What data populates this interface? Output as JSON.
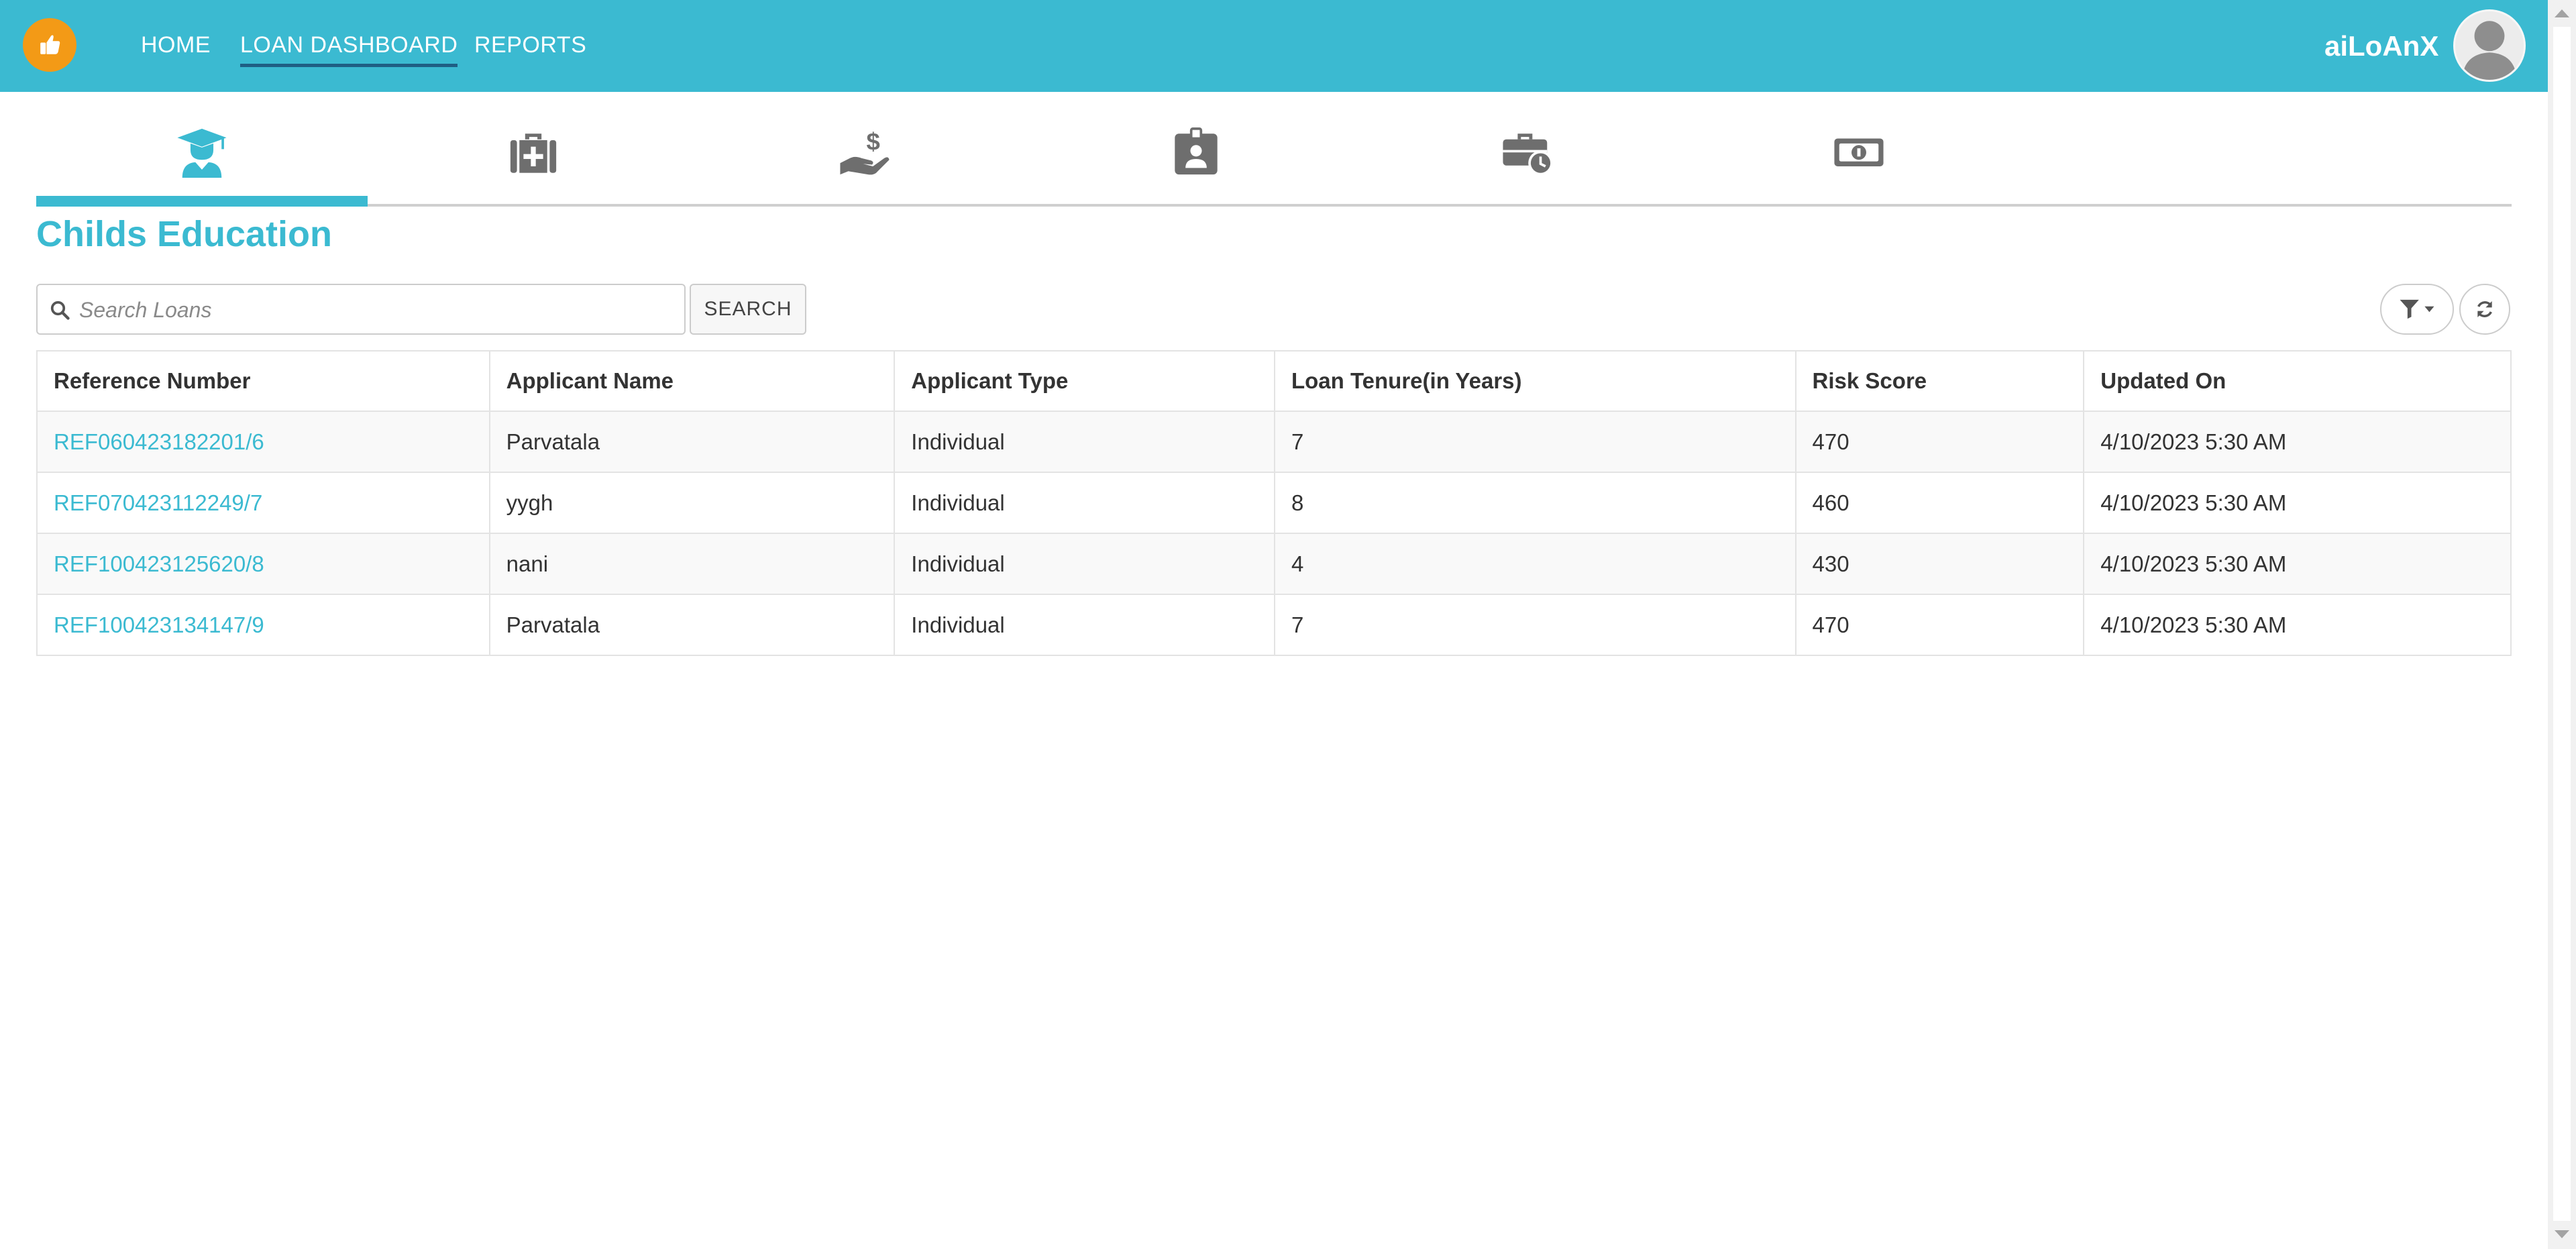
{
  "header": {
    "nav": [
      {
        "label": "HOME"
      },
      {
        "label": "LOAN DASHBOARD"
      },
      {
        "label": "REPORTS"
      }
    ],
    "brand": "aiLoAnX"
  },
  "tabs": [
    {
      "icon": "graduate-icon",
      "active": true
    },
    {
      "icon": "medical-kit-icon",
      "active": false
    },
    {
      "icon": "hand-dollar-icon",
      "active": false
    },
    {
      "icon": "id-badge-icon",
      "active": false
    },
    {
      "icon": "briefcase-clock-icon",
      "active": false
    },
    {
      "icon": "money-bill-icon",
      "active": false
    }
  ],
  "page": {
    "title": "Childs Education"
  },
  "search": {
    "placeholder": "Search Loans",
    "value": "",
    "button_label": "SEARCH"
  },
  "table": {
    "columns": [
      "Reference Number",
      "Applicant Name",
      "Applicant Type",
      "Loan Tenure(in Years)",
      "Risk Score",
      "Updated On"
    ],
    "rows": [
      [
        "REF060423182201/6",
        "Parvatala",
        "Individual",
        "7",
        "470",
        "4/10/2023 5:30 AM"
      ],
      [
        "REF070423112249/7",
        "yygh",
        "Individual",
        "8",
        "460",
        "4/10/2023 5:30 AM"
      ],
      [
        "REF100423125620/8",
        "nani",
        "Individual",
        "4",
        "430",
        "4/10/2023 5:30 AM"
      ],
      [
        "REF100423134147/9",
        "Parvatala",
        "Individual",
        "7",
        "470",
        "4/10/2023 5:30 AM"
      ]
    ]
  },
  "colors": {
    "accent": "#3bbad1",
    "logo": "#f39a16",
    "nav_underline": "#1f5f84",
    "icon_inactive": "#6e6e6e"
  }
}
